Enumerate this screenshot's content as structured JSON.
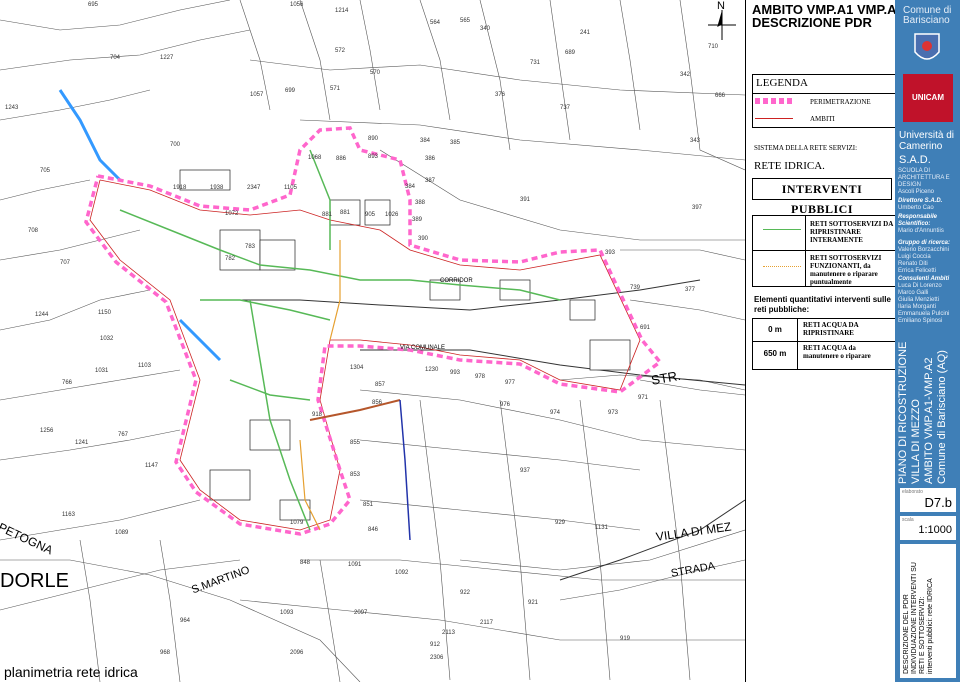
{
  "map": {
    "title": "planimetria rete idrica",
    "north_label": "N",
    "parcel_numbers": [
      "695",
      "1056",
      "1214",
      "564",
      "565",
      "340",
      "241",
      "710",
      "342",
      "666",
      "704",
      "1227",
      "572",
      "570",
      "1057",
      "699",
      "571",
      "731",
      "689",
      "376",
      "737",
      "343",
      "1243",
      "700",
      "890",
      "384",
      "385",
      "705",
      "1068",
      "886",
      "893",
      "386",
      "387",
      "384",
      "388",
      "391",
      "397",
      "377",
      "708",
      "707",
      "1072",
      "783",
      "782",
      "881",
      "881",
      "905",
      "1026",
      "389",
      "390",
      "393",
      "739",
      "691",
      "1244",
      "1032",
      "1031",
      "766",
      "1256",
      "1241",
      "767",
      "1147",
      "1163",
      "1089",
      "1150",
      "1103",
      "1304",
      "857",
      "856",
      "855",
      "853",
      "851",
      "1079",
      "846",
      "848",
      "1091",
      "1092",
      "922",
      "921",
      "929",
      "937",
      "1131",
      "1230",
      "993",
      "978",
      "977",
      "976",
      "974",
      "973",
      "971",
      "968",
      "964",
      "1093",
      "2096",
      "2097",
      "2113",
      "2117",
      "2306",
      "912",
      "919",
      "918",
      "1918",
      "1938",
      "2347",
      "1105"
    ],
    "road_labels": [
      "STR.",
      "VILLA DI MEZ",
      "STRADA",
      "PETOGNA",
      "DORLE",
      "S.MARTINO",
      "CORRIDOR",
      "VIA COMUNALE"
    ]
  },
  "legend": {
    "project_title": [
      "AMBITO VMP.A1 VMP.A2",
      "DESCRIZIONE PDR"
    ],
    "legend_title": "LEGENDA",
    "perimetrazione": "PERIMETRAZIONE",
    "ambiti": "AMBITI",
    "sistema": "SISTEMA DELLA RETE SERVIZI:",
    "rete": "RETE IDRICA.",
    "interventi": "INTERVENTI PUBBLICI",
    "items": [
      {
        "text": "RETI SOTTOSERVIZI DA RIPRISTINARE INTERAMENTE",
        "color": "#57b957"
      },
      {
        "text": "RETI SOTTOSERVIZI FUNZIONANTI, da manutenere o riparare puntualmente",
        "color": "#e6a030"
      }
    ],
    "quant_title": "Elementi quantitativi interventi sulle reti pubbliche:",
    "quant": [
      {
        "value": "0 m",
        "text": "RETI ACQUA DA RIPRISTINARE"
      },
      {
        "value": "650 m",
        "text": "RETI ACQUA da manutenere o riparare"
      }
    ]
  },
  "sidebar": {
    "comune": [
      "Comune di",
      "Barisciano"
    ],
    "unicam_logo": "UNICAM",
    "universita": [
      "Università di",
      "Camerino"
    ],
    "sad": "S.A.D.",
    "scuola": [
      "SCUOLA DI",
      "ARCHITETTURA E",
      "DESIGN",
      "Ascoli Piceno"
    ],
    "direttore": [
      "Direttore S.A.D.",
      "Umberto Cao"
    ],
    "responsabile": [
      "Responsabile",
      "Scientifico:",
      "Mario d'Annuntiis"
    ],
    "gruppo": [
      "Gruppo di ricerca:",
      "Valerio Borzacchini",
      "Luigi Coccia",
      "Renato Diti",
      "Errica Felicetti"
    ],
    "consulenti": [
      "Consulenti Ambiti",
      "Luca Di Lorenzo",
      "Marco Galli",
      "Giulia Menzietti",
      "Ilaria Morganti",
      "Emmanuela Pulcini",
      "Emiliano Spinosi"
    ],
    "piano_title": [
      "PIANO DI RICOSTRUZIONE",
      "VILLA DI MEZZO",
      "AMBITO VMP.A1-VMP.A2",
      "Comune di Barisciano (AQ)"
    ],
    "elaborato_label": "elaborato",
    "elaborato": "D7.b",
    "scala_label": "scala",
    "scala": "1:1000",
    "bottom": [
      "DESCRIZIONE DEL PDR",
      "INDIVIDUAZIONE INTERVENTI SU",
      "RETI E SOTTOSERVIZI:",
      "interventi pubblici: rete IDRICA"
    ]
  }
}
